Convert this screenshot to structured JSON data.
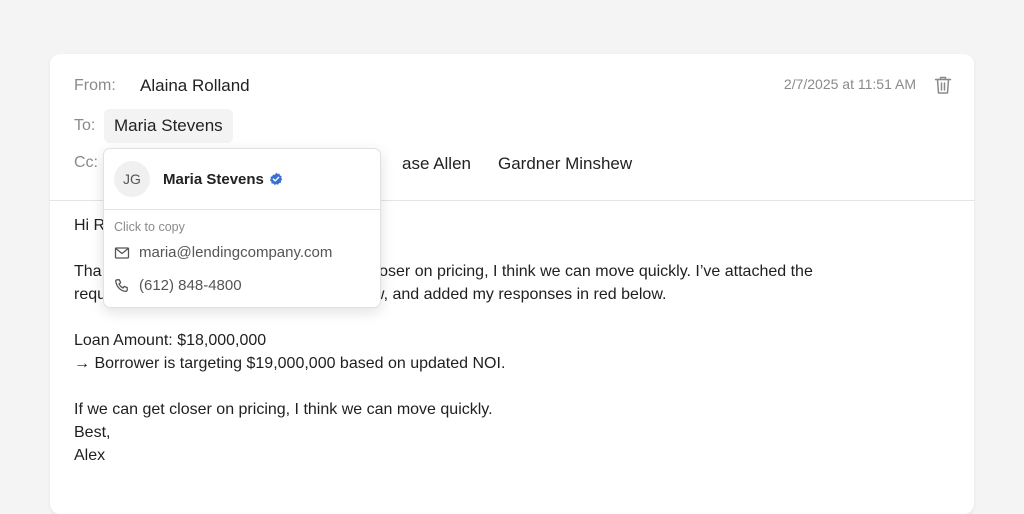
{
  "email": {
    "from_label": "From:",
    "from_name": "Alaina Rolland",
    "to_label": "To:",
    "to_name": "Maria Stevens",
    "cc_label": "Cc:",
    "cc_names": [
      "ase Allen",
      "Gardner Minshew"
    ],
    "timestamp": "2/7/2025 at 11:51 AM",
    "body": {
      "line1": "Hi R",
      "line2a": "Tha",
      "line2b": "closer on pricing, I think we can move quickly. I’ve attached the",
      "line3a": "requ",
      "line3b": "ew, and added my responses in red below.",
      "line4": "Loan Amount: $18,000,000",
      "line5": "→ Borrower is targeting $19,000,000 based on updated NOI.",
      "line6": "If we can get closer on pricing, I think we can move quickly.",
      "line7": "Best,",
      "line8": "Alex"
    }
  },
  "popover": {
    "initials": "JG",
    "name": "Maria Stevens",
    "click_to_copy": "Click to copy",
    "email": "maria@lendingcompany.com",
    "phone": "(612) 848-4800",
    "verified_color": "#3b6fd4"
  },
  "icons": {
    "trash": "trash-icon",
    "mail": "mail-icon",
    "phone": "phone-icon",
    "verified": "verified-badge-icon"
  }
}
